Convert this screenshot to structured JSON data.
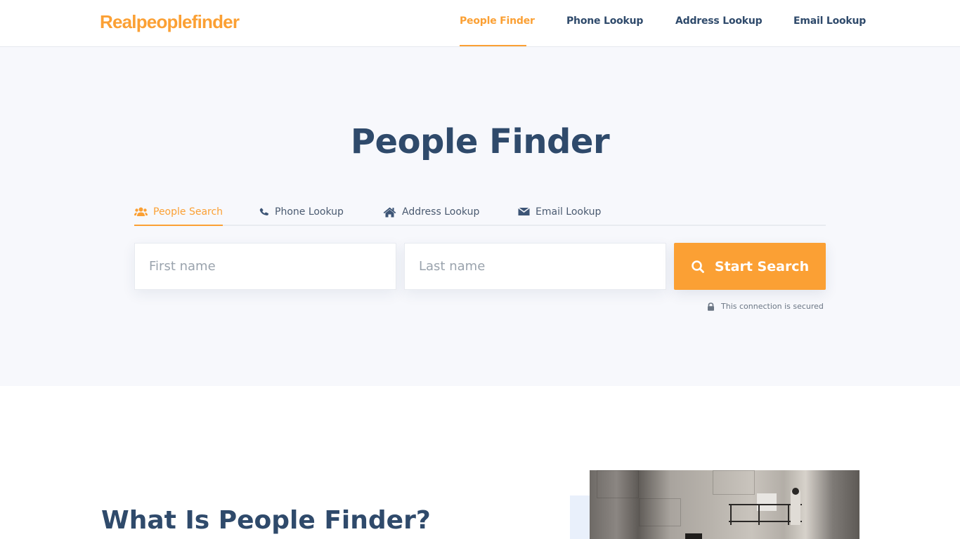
{
  "header": {
    "logo": "Realpeoplefinder",
    "nav": [
      {
        "label": "People Finder",
        "active": true
      },
      {
        "label": "Phone Lookup",
        "active": false
      },
      {
        "label": "Address Lookup",
        "active": false
      },
      {
        "label": "Email Lookup",
        "active": false
      }
    ]
  },
  "hero": {
    "title": "People Finder",
    "tabs": [
      {
        "label": "People Search",
        "icon": "users-icon",
        "active": true
      },
      {
        "label": "Phone Lookup",
        "icon": "phone-icon",
        "active": false
      },
      {
        "label": "Address Lookup",
        "icon": "home-icon",
        "active": false
      },
      {
        "label": "Email Lookup",
        "icon": "envelope-icon",
        "active": false
      }
    ],
    "first_name": {
      "value": "",
      "placeholder": "First name"
    },
    "last_name": {
      "value": "",
      "placeholder": "Last name"
    },
    "search_button": "Start Search",
    "secure_note": "This connection is secured"
  },
  "about": {
    "title": "What Is People Finder?"
  },
  "colors": {
    "brand": "#fba034",
    "heading": "#2f4a6b",
    "hero_bg": "#f7f8fc"
  }
}
